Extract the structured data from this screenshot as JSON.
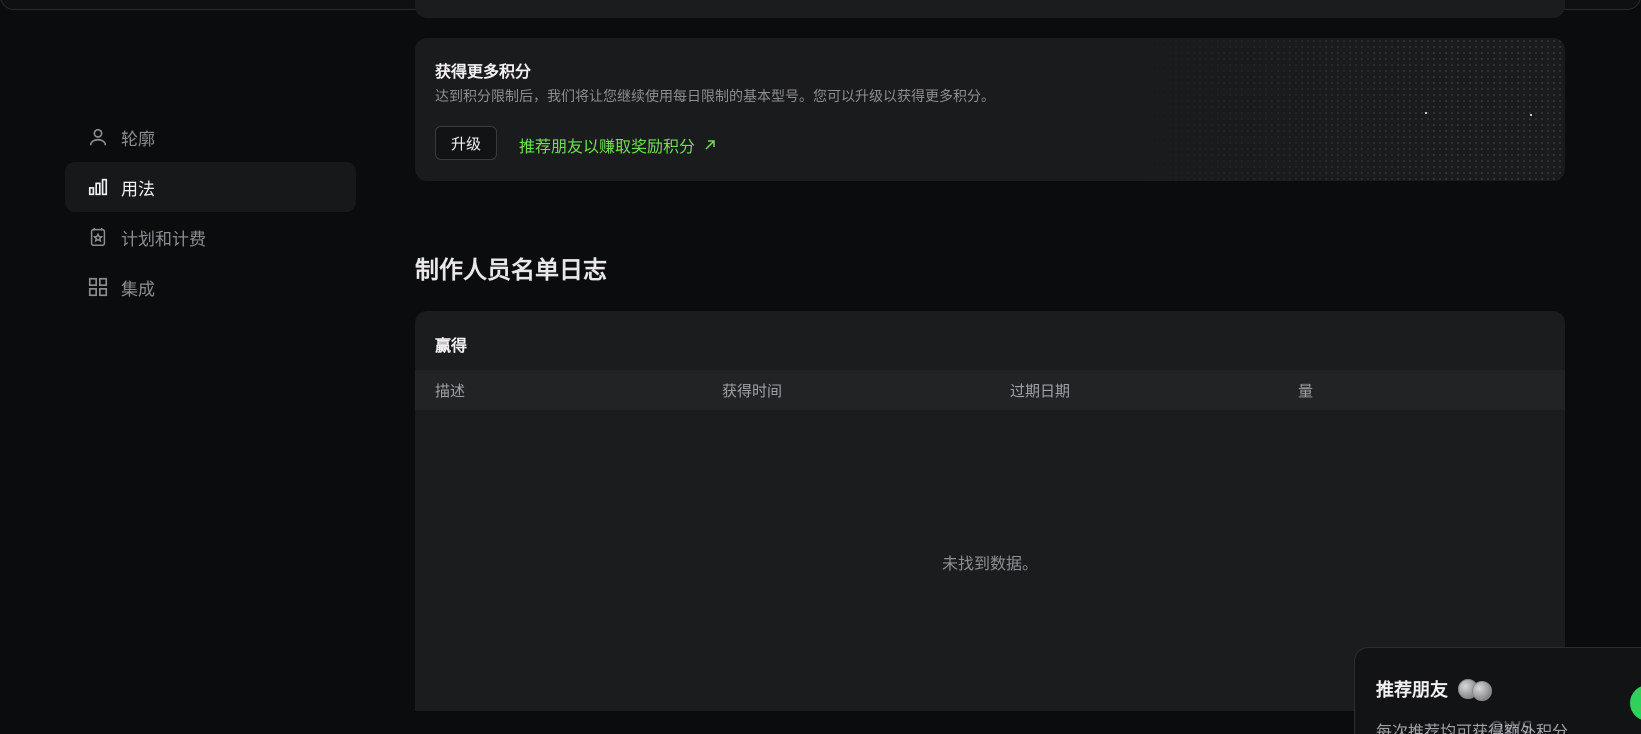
{
  "sidebar": {
    "items": [
      {
        "label": "轮廓",
        "icon": "user-icon"
      },
      {
        "label": "用法",
        "icon": "bar-chart-icon"
      },
      {
        "label": "计划和计费",
        "icon": "billing-icon"
      },
      {
        "label": "集成",
        "icon": "grid-icon"
      }
    ],
    "active_index": 1
  },
  "credits_card": {
    "title": "获得更多积分",
    "description": "达到积分限制后，我们将让您继续使用每日限制的基本型号。您可以升级以获得更多积分。",
    "upgrade_label": "升级",
    "refer_label": "推荐朋友以赚取奖励积分"
  },
  "credit_log": {
    "title": "制作人员名单日志",
    "table_caption": "赢得",
    "columns": [
      "描述",
      "获得时间",
      "过期日期",
      "量"
    ],
    "rows": [],
    "empty_message": "未找到数据。"
  },
  "popup": {
    "title": "推荐朋友",
    "description": "每次推荐均可获得额外积分"
  },
  "watermark": "ows",
  "colors": {
    "accent_green": "#6ee04f",
    "background": "#0b0c0e",
    "card": "#1a1b1d"
  }
}
